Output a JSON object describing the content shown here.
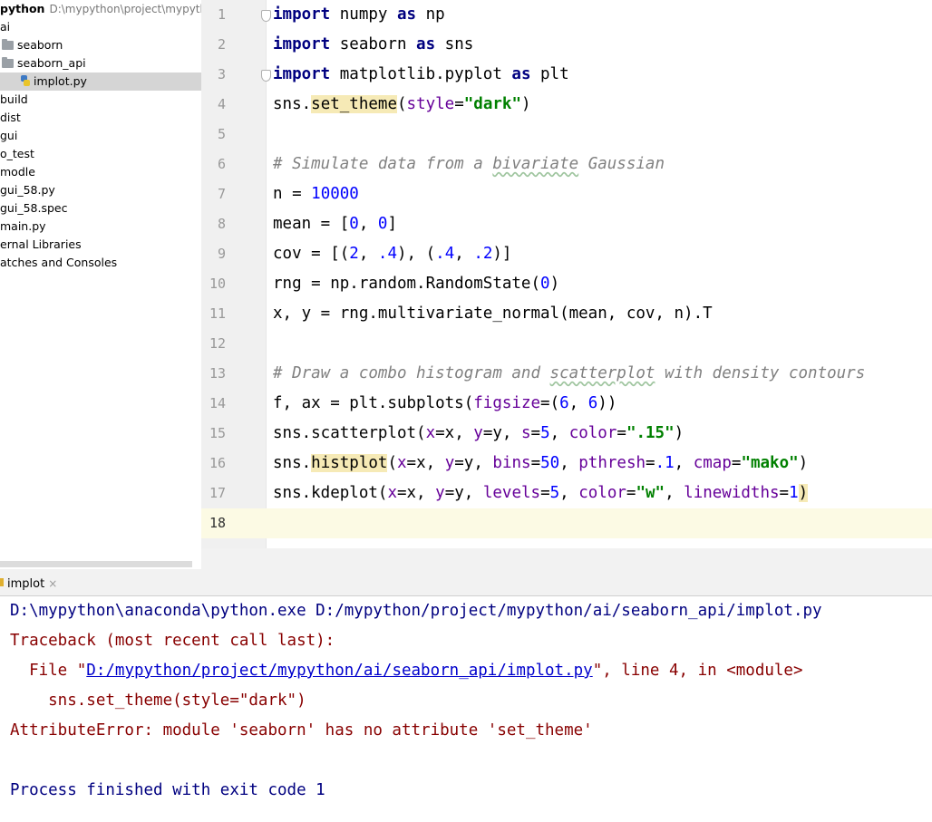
{
  "project_tree": {
    "root_name": "python",
    "root_path": "D:\\mypython\\project\\mypytho",
    "items": [
      {
        "label": "ai",
        "type": "folder"
      },
      {
        "label": "seaborn",
        "type": "folder"
      },
      {
        "label": "seaborn_api",
        "type": "folder"
      },
      {
        "label": "implot.py",
        "type": "file",
        "selected": true
      },
      {
        "label": "build",
        "type": "folder"
      },
      {
        "label": "dist",
        "type": "folder"
      },
      {
        "label": "gui",
        "type": "folder"
      },
      {
        "label": "o_test",
        "type": "folder"
      },
      {
        "label": "modle",
        "type": "folder"
      },
      {
        "label": "gui_58.py",
        "type": "file"
      },
      {
        "label": "gui_58.spec",
        "type": "file"
      },
      {
        "label": "main.py",
        "type": "file"
      },
      {
        "label": "ernal Libraries",
        "type": "group"
      },
      {
        "label": "atches and Consoles",
        "type": "group"
      }
    ]
  },
  "editor": {
    "line_numbers": [
      "1",
      "2",
      "3",
      "4",
      "5",
      "6",
      "7",
      "8",
      "9",
      "10",
      "11",
      "12",
      "13",
      "14",
      "15",
      "16",
      "17",
      "18"
    ],
    "current_line": 18,
    "lines": [
      [
        {
          "t": "import",
          "c": "kw"
        },
        {
          "t": " numpy "
        },
        {
          "t": "as",
          "c": "kw"
        },
        {
          "t": " np"
        }
      ],
      [
        {
          "t": "import",
          "c": "kw"
        },
        {
          "t": " seaborn "
        },
        {
          "t": "as",
          "c": "kw"
        },
        {
          "t": " sns"
        }
      ],
      [
        {
          "t": "import",
          "c": "kw"
        },
        {
          "t": " matplotlib.pyplot "
        },
        {
          "t": "as",
          "c": "kw"
        },
        {
          "t": " plt"
        }
      ],
      [
        {
          "t": "sns."
        },
        {
          "t": "set_theme",
          "c": "hl"
        },
        {
          "t": "("
        },
        {
          "t": "style",
          "c": "kwarg"
        },
        {
          "t": "="
        },
        {
          "t": "\"dark\"",
          "c": "str"
        },
        {
          "t": ")"
        }
      ],
      [],
      [
        {
          "t": "# Simulate data from a ",
          "c": "cmt"
        },
        {
          "t": "bivariate",
          "c": "cmt sq"
        },
        {
          "t": " Gaussian",
          "c": "cmt"
        }
      ],
      [
        {
          "t": "n = "
        },
        {
          "t": "10000",
          "c": "num"
        }
      ],
      [
        {
          "t": "mean = ["
        },
        {
          "t": "0",
          "c": "num"
        },
        {
          "t": ", "
        },
        {
          "t": "0",
          "c": "num"
        },
        {
          "t": "]"
        }
      ],
      [
        {
          "t": "cov = [("
        },
        {
          "t": "2",
          "c": "num"
        },
        {
          "t": ", "
        },
        {
          "t": ".4",
          "c": "num"
        },
        {
          "t": "), ("
        },
        {
          "t": ".4",
          "c": "num"
        },
        {
          "t": ", "
        },
        {
          "t": ".2",
          "c": "num"
        },
        {
          "t": ")]"
        }
      ],
      [
        {
          "t": "rng = np.random.RandomState("
        },
        {
          "t": "0",
          "c": "num"
        },
        {
          "t": ")"
        }
      ],
      [
        {
          "t": "x, y = rng.multivariate_normal(mean, cov, n).T"
        }
      ],
      [],
      [
        {
          "t": "# Draw a combo histogram and ",
          "c": "cmt"
        },
        {
          "t": "scatterplot",
          "c": "cmt sq"
        },
        {
          "t": " with density contours",
          "c": "cmt"
        }
      ],
      [
        {
          "t": "f, ax = plt.subplots("
        },
        {
          "t": "figsize",
          "c": "kwarg"
        },
        {
          "t": "=("
        },
        {
          "t": "6",
          "c": "num"
        },
        {
          "t": ", "
        },
        {
          "t": "6",
          "c": "num"
        },
        {
          "t": "))"
        }
      ],
      [
        {
          "t": "sns.scatterplot("
        },
        {
          "t": "x",
          "c": "kwarg"
        },
        {
          "t": "=x, "
        },
        {
          "t": "y",
          "c": "kwarg"
        },
        {
          "t": "=y, "
        },
        {
          "t": "s",
          "c": "kwarg"
        },
        {
          "t": "="
        },
        {
          "t": "5",
          "c": "num"
        },
        {
          "t": ", "
        },
        {
          "t": "color",
          "c": "kwarg"
        },
        {
          "t": "="
        },
        {
          "t": "\".15\"",
          "c": "str"
        },
        {
          "t": ")"
        }
      ],
      [
        {
          "t": "sns."
        },
        {
          "t": "histplot",
          "c": "hl"
        },
        {
          "t": "("
        },
        {
          "t": "x",
          "c": "kwarg"
        },
        {
          "t": "=x, "
        },
        {
          "t": "y",
          "c": "kwarg"
        },
        {
          "t": "=y, "
        },
        {
          "t": "bins",
          "c": "kwarg"
        },
        {
          "t": "="
        },
        {
          "t": "50",
          "c": "num"
        },
        {
          "t": ", "
        },
        {
          "t": "pthresh",
          "c": "kwarg"
        },
        {
          "t": "="
        },
        {
          "t": ".1",
          "c": "num"
        },
        {
          "t": ", "
        },
        {
          "t": "cmap",
          "c": "kwarg"
        },
        {
          "t": "="
        },
        {
          "t": "\"mako\"",
          "c": "str"
        },
        {
          "t": ")"
        }
      ],
      [
        {
          "t": "sns.kdeplot("
        },
        {
          "t": "x",
          "c": "kwarg"
        },
        {
          "t": "=x, "
        },
        {
          "t": "y",
          "c": "kwarg"
        },
        {
          "t": "=y, "
        },
        {
          "t": "levels",
          "c": "kwarg"
        },
        {
          "t": "="
        },
        {
          "t": "5",
          "c": "num"
        },
        {
          "t": ", "
        },
        {
          "t": "color",
          "c": "kwarg"
        },
        {
          "t": "="
        },
        {
          "t": "\"w\"",
          "c": "str"
        },
        {
          "t": ", "
        },
        {
          "t": "linewidths",
          "c": "kwarg"
        },
        {
          "t": "="
        },
        {
          "t": "1",
          "c": "num"
        },
        {
          "t": ")",
          "c": "hl"
        }
      ],
      []
    ]
  },
  "run_panel": {
    "tab_label": "implot",
    "tab_close": "×",
    "console": {
      "command": "D:\\mypython\\anaconda\\python.exe D:/mypython/project/mypython/ai/seaborn_api/implot.py",
      "traceback_header": "Traceback (most recent call last):",
      "file_prefix": "  File \"",
      "file_link": "D:/mypython/project/mypython/ai/seaborn_api/implot.py",
      "file_suffix": "\", line 4, in <module>",
      "source_line": "    sns.set_theme(style=\"dark\")",
      "error": "AttributeError: module 'seaborn' has no attribute 'set_theme'",
      "exit": "Process finished with exit code 1"
    }
  },
  "colors": {
    "keyword": "#000080",
    "string": "#008000",
    "number": "#0000ff",
    "kwarg": "#660099",
    "comment": "#808080",
    "error": "#880000",
    "selection": "#d5d5d5",
    "current_line": "#fcfae4"
  }
}
